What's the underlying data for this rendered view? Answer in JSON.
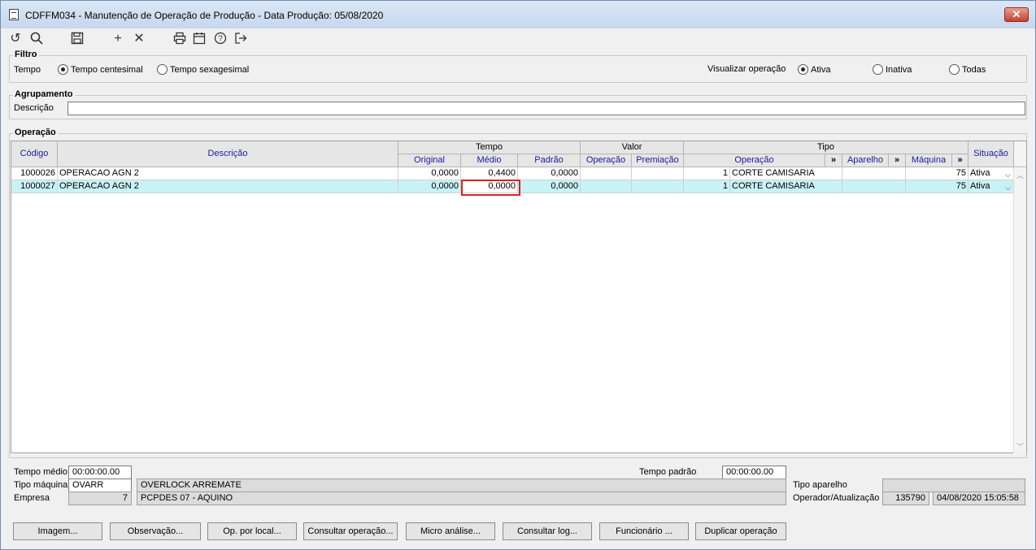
{
  "window": {
    "title": "CDFFM034 - Manutenção de Operação de Produção - Data Produção: 05/08/2020",
    "close_label": "✕"
  },
  "toolbar": {
    "icons": [
      "refresh-icon",
      "search-icon",
      "save-icon",
      "add-icon",
      "delete-icon",
      "print-icon",
      "calendar-icon",
      "help-icon",
      "exit-icon"
    ]
  },
  "filtro": {
    "legend": "Filtro",
    "tempo_label": "Tempo",
    "tempo_options": [
      "Tempo centesimal",
      "Tempo sexagesimal"
    ],
    "tempo_selected": "Tempo centesimal",
    "visualizar_label": "Visualizar operação",
    "visualizar_options": [
      "Ativa",
      "Inativa",
      "Todas"
    ],
    "visualizar_selected": "Ativa"
  },
  "agrupamento": {
    "legend": "Agrupamento",
    "descricao_label": "Descrição",
    "descricao_value": ""
  },
  "operacao": {
    "legend": "Operação",
    "headers": {
      "codigo": "Código",
      "descricao": "Descrição",
      "tempo": "Tempo",
      "original": "Original",
      "medio": "Médio",
      "padrao": "Padrão",
      "valor": "Valor",
      "valor_operacao": "Operação",
      "premiacao": "Premiação",
      "tipo": "Tipo",
      "tipo_operacao": "Operação",
      "aparelho": "Aparelho",
      "maquina": "Máquina",
      "situacao": "Situação",
      "expand": "»"
    },
    "rows": [
      {
        "codigo": "1000026",
        "descricao": "OPERACAO AGN 2",
        "original": "0,0000",
        "medio": "0,4400",
        "padrao": "0,0000",
        "valor_operacao": "",
        "premiacao": "",
        "tipo_operacao_num": "1",
        "tipo_operacao_desc": "CORTE CAMISARIA",
        "aparelho": "",
        "maquina": "75",
        "situacao": "Ativa"
      },
      {
        "codigo": "1000027",
        "descricao": "OPERACAO AGN 2",
        "original": "0,0000",
        "medio": "0,0000",
        "padrao": "0,0000",
        "valor_operacao": "",
        "premiacao": "",
        "tipo_operacao_num": "1",
        "tipo_operacao_desc": "CORTE CAMISARIA",
        "aparelho": "",
        "maquina": "75",
        "situacao": "Ativa"
      }
    ]
  },
  "footer": {
    "tempo_medio_label": "Tempo médio",
    "tempo_medio_value": "00:00:00.00",
    "tempo_padrao_label": "Tempo padrão",
    "tempo_padrao_value": "00:00:00.00",
    "tipo_maquina_label": "Tipo máquina",
    "tipo_maquina_code": "OVARR",
    "tipo_maquina_desc": "OVERLOCK ARREMATE",
    "empresa_label": "Empresa",
    "empresa_code": "7",
    "empresa_desc": "PCPDES 07 - AQUINO",
    "tipo_aparelho_label": "Tipo aparelho",
    "tipo_aparelho_value": "",
    "operador_label": "Operador/Atualização",
    "operador_value": "135790",
    "atualizacao_value": "04/08/2020 15:05:58"
  },
  "buttons": [
    "Imagem...",
    "Observação...",
    "Op. por local...",
    "Consultar operação...",
    "Micro análise...",
    "Consultar log...",
    "Funcionário ...",
    "Duplicar operação"
  ]
}
